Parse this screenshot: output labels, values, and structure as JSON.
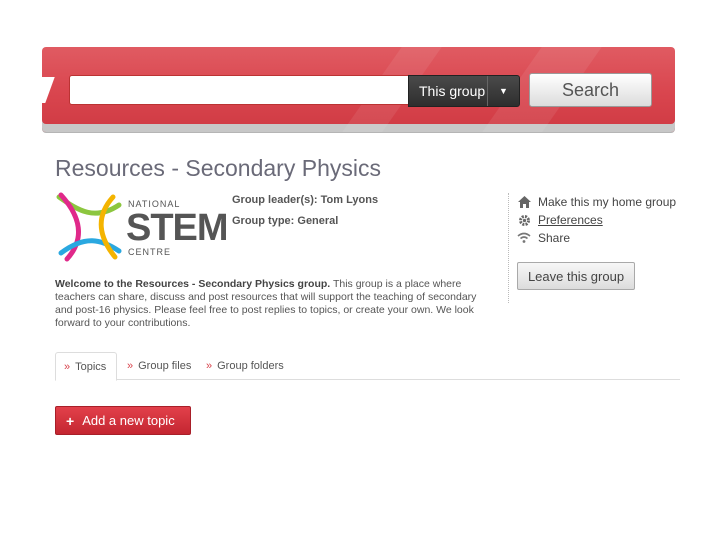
{
  "search": {
    "input_value": "",
    "scope_label": "This group",
    "button_label": "Search"
  },
  "page": {
    "title": "Resources - Secondary Physics"
  },
  "logo": {
    "line1": "NATIONAL",
    "line2": "STEM",
    "line3": "CENTRE"
  },
  "group": {
    "leader": "Group leader(s): Tom Lyons",
    "type": "Group type: General",
    "welcome_bold": "Welcome to the Resources - Secondary Physics group.",
    "welcome_text": " This group is a place where teachers can share, discuss and post resources that will support the teaching of secondary and post-16 physics. Please feel free to post replies to topics, or create your own. We look forward to your contributions."
  },
  "actions": {
    "home": "Make this my home group",
    "preferences": "Preferences",
    "share": "Share",
    "leave": "Leave this group"
  },
  "tabs": [
    {
      "label": "Topics",
      "active": true
    },
    {
      "label": "Group files",
      "active": false
    },
    {
      "label": "Group folders",
      "active": false
    }
  ],
  "buttons": {
    "add_topic": "Add a new topic"
  },
  "colors": {
    "accent": "#d9454e",
    "logo_pink": "#e0298a",
    "logo_blue": "#2aa8e0",
    "logo_green": "#8cc63f",
    "logo_yellow": "#f4b400"
  }
}
